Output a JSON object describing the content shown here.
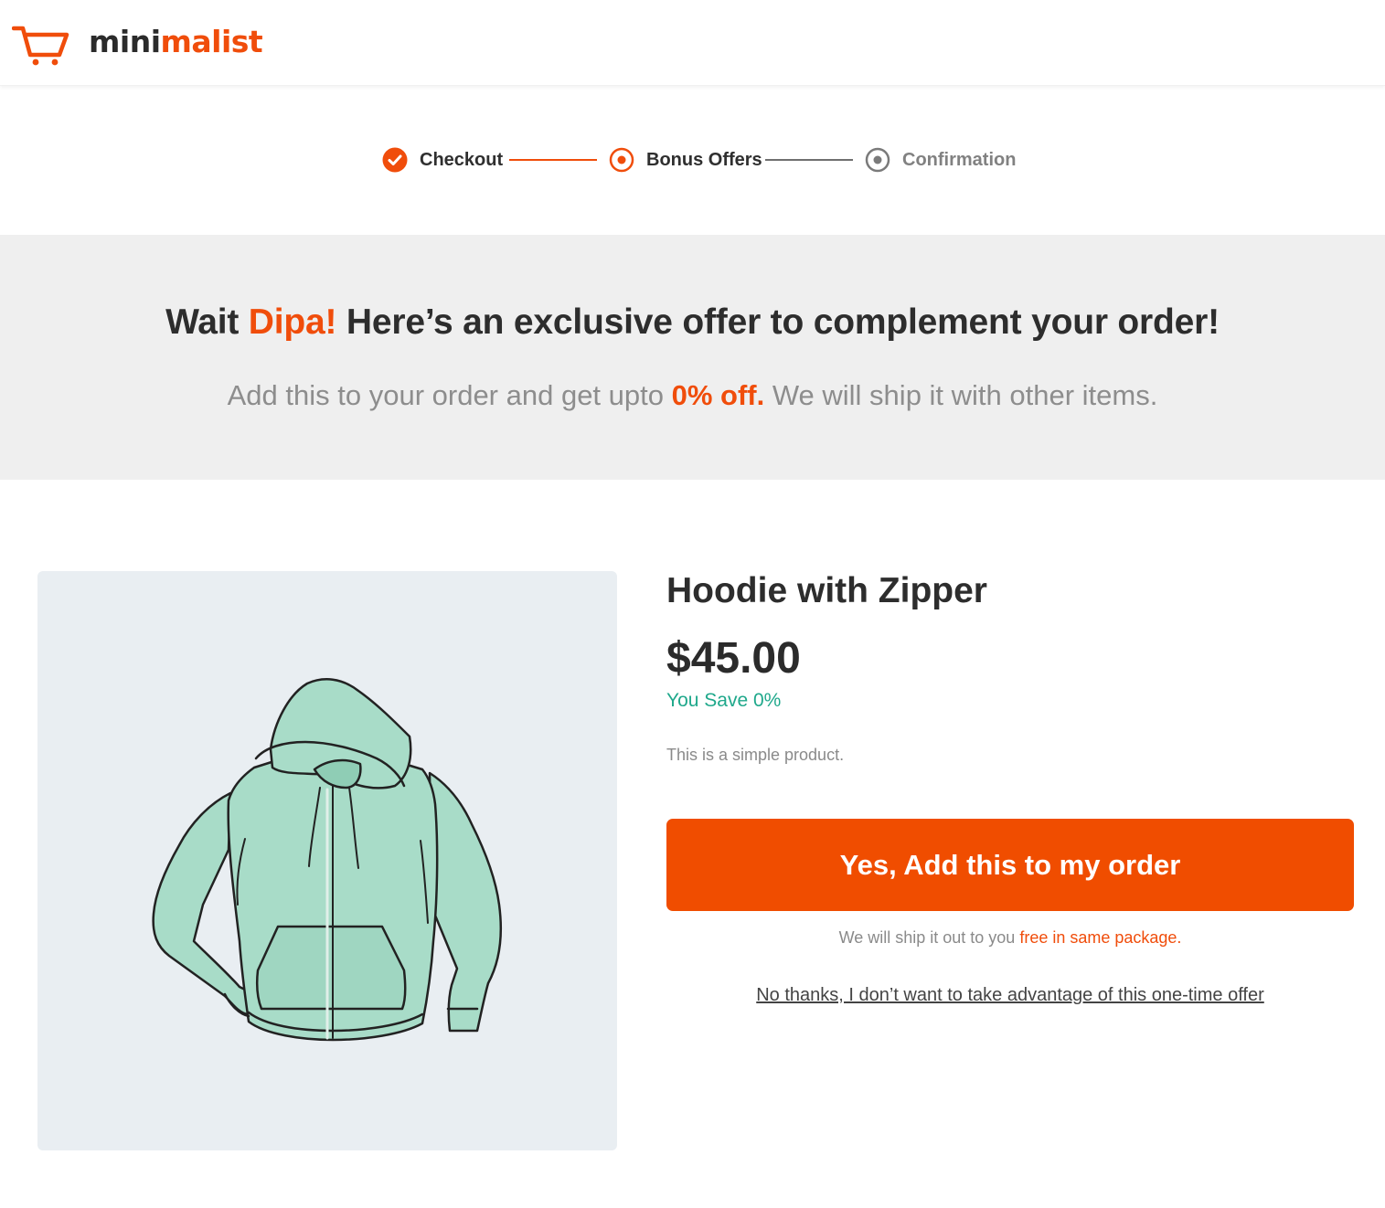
{
  "brand": {
    "logo_part_1": "mini",
    "logo_part_2": "malist",
    "accent_color": "#f04d0b",
    "cart_icon": "shopping-cart-icon"
  },
  "steps": [
    {
      "label": "Checkout",
      "state": "completed",
      "icon": "check-circle-icon"
    },
    {
      "label": "Bonus Offers",
      "state": "active",
      "icon": "radio-dot-icon"
    },
    {
      "label": "Confirmation",
      "state": "pending",
      "icon": "radio-dot-icon"
    }
  ],
  "banner": {
    "title_prefix": "Wait ",
    "customer_name": "Dipa!",
    "title_suffix": " Here’s an exclusive offer to complement your order!",
    "subtitle_prefix": "Add this to your order and get upto ",
    "discount": "0% off.",
    "subtitle_suffix": " We will ship it with other items."
  },
  "product": {
    "image_icon": "hoodie-image",
    "title": "Hoodie with Zipper",
    "price": "$45.00",
    "savings": "You Save 0%",
    "description": "This is a simple product.",
    "savings_color": "#1fa88b"
  },
  "actions": {
    "accept_label": "Yes, Add this to my order",
    "ship_note_prefix": "We will ship it out to you ",
    "ship_note_highlight": "free in same package.",
    "decline_label": "No thanks, I don’t want to take advantage of this one-time offer"
  }
}
